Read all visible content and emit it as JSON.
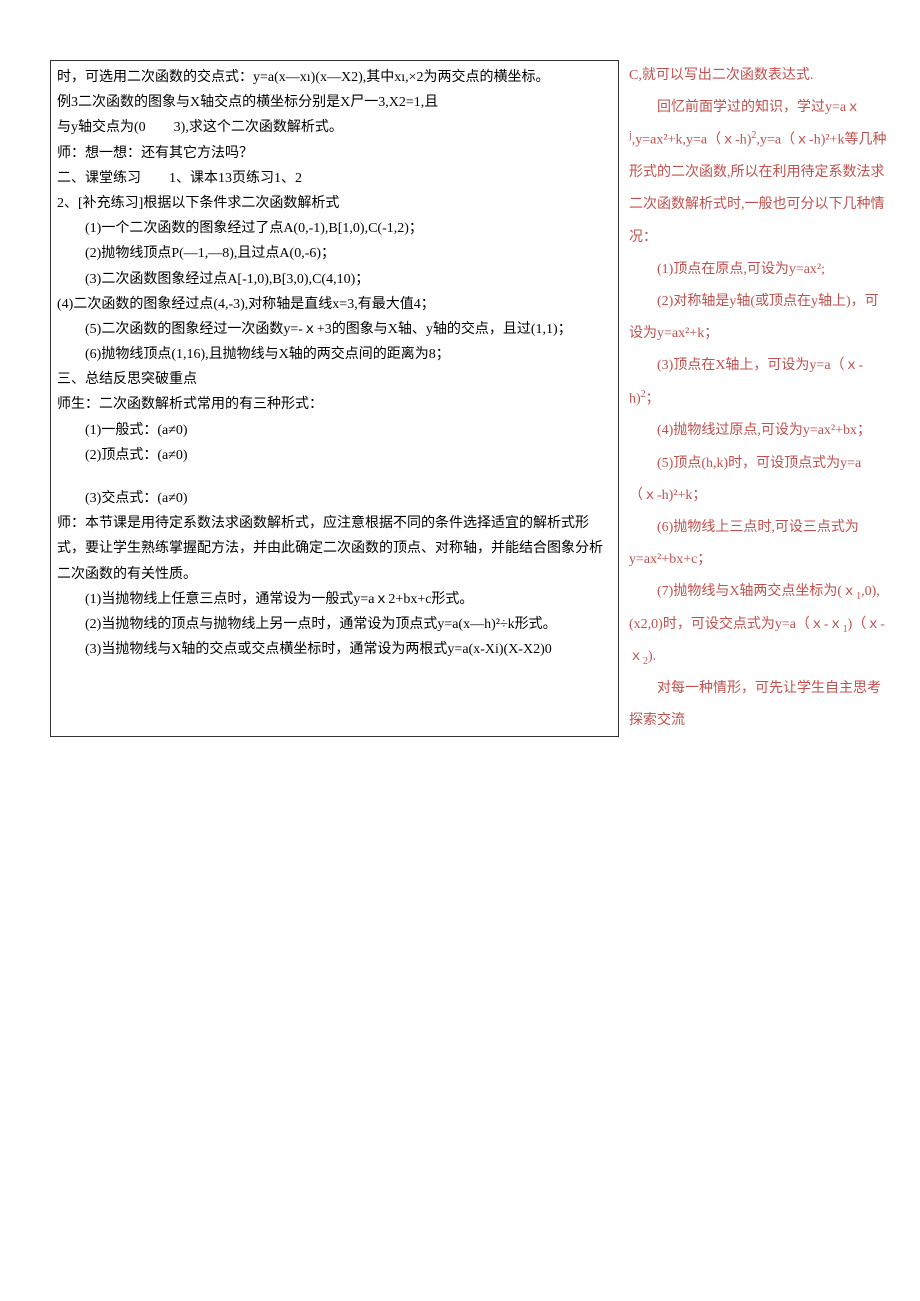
{
  "left": {
    "p1": "时，可选用二次函数的交点式：y=a(x—xı)(x—X2),其中xı,×2为两交点的横坐标。",
    "p2": "例3二次函数的图象与X轴交点的横坐标分别是X尸一3,X2=1,且",
    "p3": "与y轴交点为(0　　3),求这个二次函数解析式。",
    "p4": "师：想一想：还有其它方法吗？",
    "p5": "二、课堂练习　　1、课本13页练习1、2",
    "p6": "2、[补充练习]根据以下条件求二次函数解析式",
    "p7": "(1)一个二次函数的图象经过了点A(0,-1),B[1,0),C(-1,2)；",
    "p8": "(2)抛物线顶点P(—1,—8),且过点A(0,-6)；",
    "p9": "(3)二次函数图象经过点A[-1,0),B[3,0),C(4,10)；",
    "p10": "(4)二次函数的图象经过点(4,-3),对称轴是直线x=3,有最大值4；",
    "p11": "(5)二次函数的图象经过一次函数y=-ｘ+3的图象与X轴、y轴的交点，且过(1,1)；",
    "p12": "(6)抛物线顶点(1,16),且抛物线与X轴的两交点间的距离为8；",
    "p13": "三、总结反思突破重点",
    "p14": "师生：二次函数解析式常用的有三种形式：",
    "p15": "(1)一般式：(a≠0)",
    "p16": "(2)顶点式：(a≠0)",
    "p17": "(3)交点式：(a≠0)",
    "p18": "师：本节课是用待定系数法求函数解析式，应注意根据不同的条件选择适宜的解析式形式，要让学生熟练掌握配方法，并由此确定二次函数的顶点、对称轴，并能结合图象分析二次函数的有关性质。",
    "p19": "(1)当抛物线上任意三点时，通常设为一般式y=aｘ2+bx+c形式。",
    "p20": "(2)当抛物线的顶点与抛物线上另一点时，通常设为顶点式y=a(x—h)²÷k形式。",
    "p21": "(3)当抛物线与X轴的交点或交点横坐标时，通常设为两根式y=a(x-Xi)(X-X2)0"
  },
  "right": {
    "r1": "C,就可以写出二次函数表达式.",
    "r2_a": "回忆前面学过的知识，学过y=aｘ",
    "r2_b": ",y=ax²+k,y=a（ｘ-h)",
    "r2_c": ",y=a（ｘ-h)²+k等几种形式的二次函数,所以在利用待定系数法求二次函数解析式时,一般也可分以下几种情况：",
    "r3": "(1)顶点在原点,可设为y=ax²;",
    "r4": "(2)对称轴是y轴(或顶点在y轴上)，可设为y=ax²+k；",
    "r5_a": "(3)顶点在X轴上，可设为y=a（ｘ-h)",
    "r5_b": "；",
    "r6": "(4)抛物线过原点,可设为y=ax²+bx；",
    "r7": "(5)顶点(h,k)时，可设顶点式为y=a（ｘ-h)²+k；",
    "r8": "(6)抛物线上三点时,可设三点式为y=ax²+bx+c；",
    "r9_a": "(7)抛物线与X轴两交点坐标为(ｘ",
    "r9_b": ",0),(x2,0)时，可设交点式为y=a（ｘ-ｘ",
    "r9_c": ")（ｘ-ｘ",
    "r9_d": ").",
    "r10": "对每一种情形，可先让学生自主思考探索交流"
  }
}
